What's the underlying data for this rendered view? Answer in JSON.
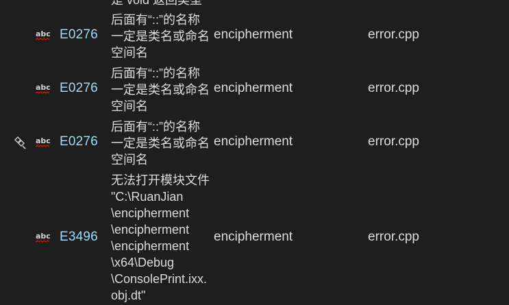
{
  "clipped_top_text": "是 void 返回类型",
  "rows": [
    {
      "code": "E0276",
      "description": "后面有“::”的名称\n一定是类名或命名\n空间名",
      "project": "encipherment",
      "file": "error.cpp",
      "icon": "spell-check-icon",
      "has_fix_icon": false
    },
    {
      "code": "E0276",
      "description": "后面有“::”的名称\n一定是类名或命名\n空间名",
      "project": "encipherment",
      "file": "error.cpp",
      "icon": "spell-check-icon",
      "has_fix_icon": false
    },
    {
      "code": "E0276",
      "description": "后面有“::”的名称\n一定是类名或命名\n空间名",
      "project": "encipherment",
      "file": "error.cpp",
      "icon": "spell-check-icon",
      "has_fix_icon": true
    },
    {
      "code": "E3496",
      "description": "无法打开模块文件\n\"C:\\RuanJian\n\\encipherment\n\\encipherment\n\\encipherment\n\\x64\\Debug\n\\ConsolePrint.ixx.\nobj.dt\"",
      "project": "encipherment",
      "file": "error.cpp",
      "icon": "spell-check-icon",
      "has_fix_icon": false
    }
  ],
  "icon_label": "abc",
  "colors": {
    "background": "#1e1e1e",
    "code": "#9cdcfe",
    "text": "#dcdcdc",
    "squiggle": "#e51400"
  }
}
